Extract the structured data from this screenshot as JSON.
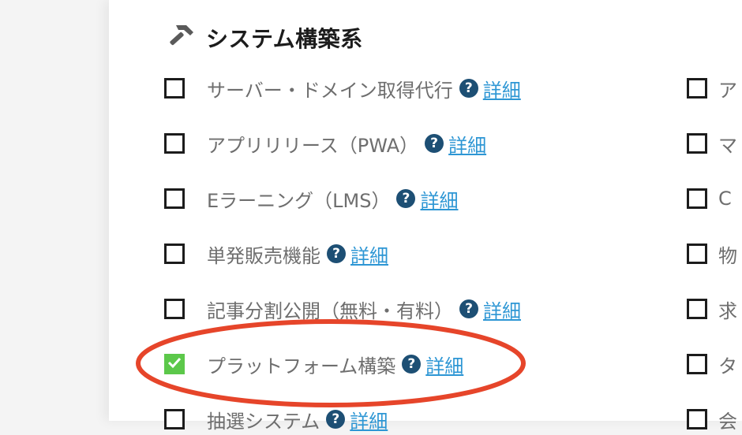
{
  "section": {
    "title": "システム構築系",
    "icon": "hammer-icon"
  },
  "help_glyph": "?",
  "left_items": [
    {
      "label": "サーバー・ドメイン取得代行",
      "detail": "詳細",
      "checked": false
    },
    {
      "label": "アプリリリース（PWA）",
      "detail": "詳細",
      "checked": false
    },
    {
      "label": "Eラーニング（LMS）",
      "detail": "詳細",
      "checked": false
    },
    {
      "label": "単発販売機能",
      "detail": "詳細",
      "checked": false
    },
    {
      "label": "記事分割公開（無料・有料）",
      "detail": "詳細",
      "checked": false
    },
    {
      "label": "プラットフォーム構築",
      "detail": "詳細",
      "checked": true
    },
    {
      "label": "抽選システム",
      "detail": "詳細",
      "checked": false
    }
  ],
  "right_items": [
    {
      "label": "ア"
    },
    {
      "label": "マ"
    },
    {
      "label": "C"
    },
    {
      "label": "物"
    },
    {
      "label": "求"
    },
    {
      "label": "タ"
    },
    {
      "label": "会"
    }
  ],
  "colors": {
    "checked": "#5cc84a",
    "help_badge": "#1d4f74",
    "link": "#2d96d4",
    "annotation": "#e6452a"
  }
}
